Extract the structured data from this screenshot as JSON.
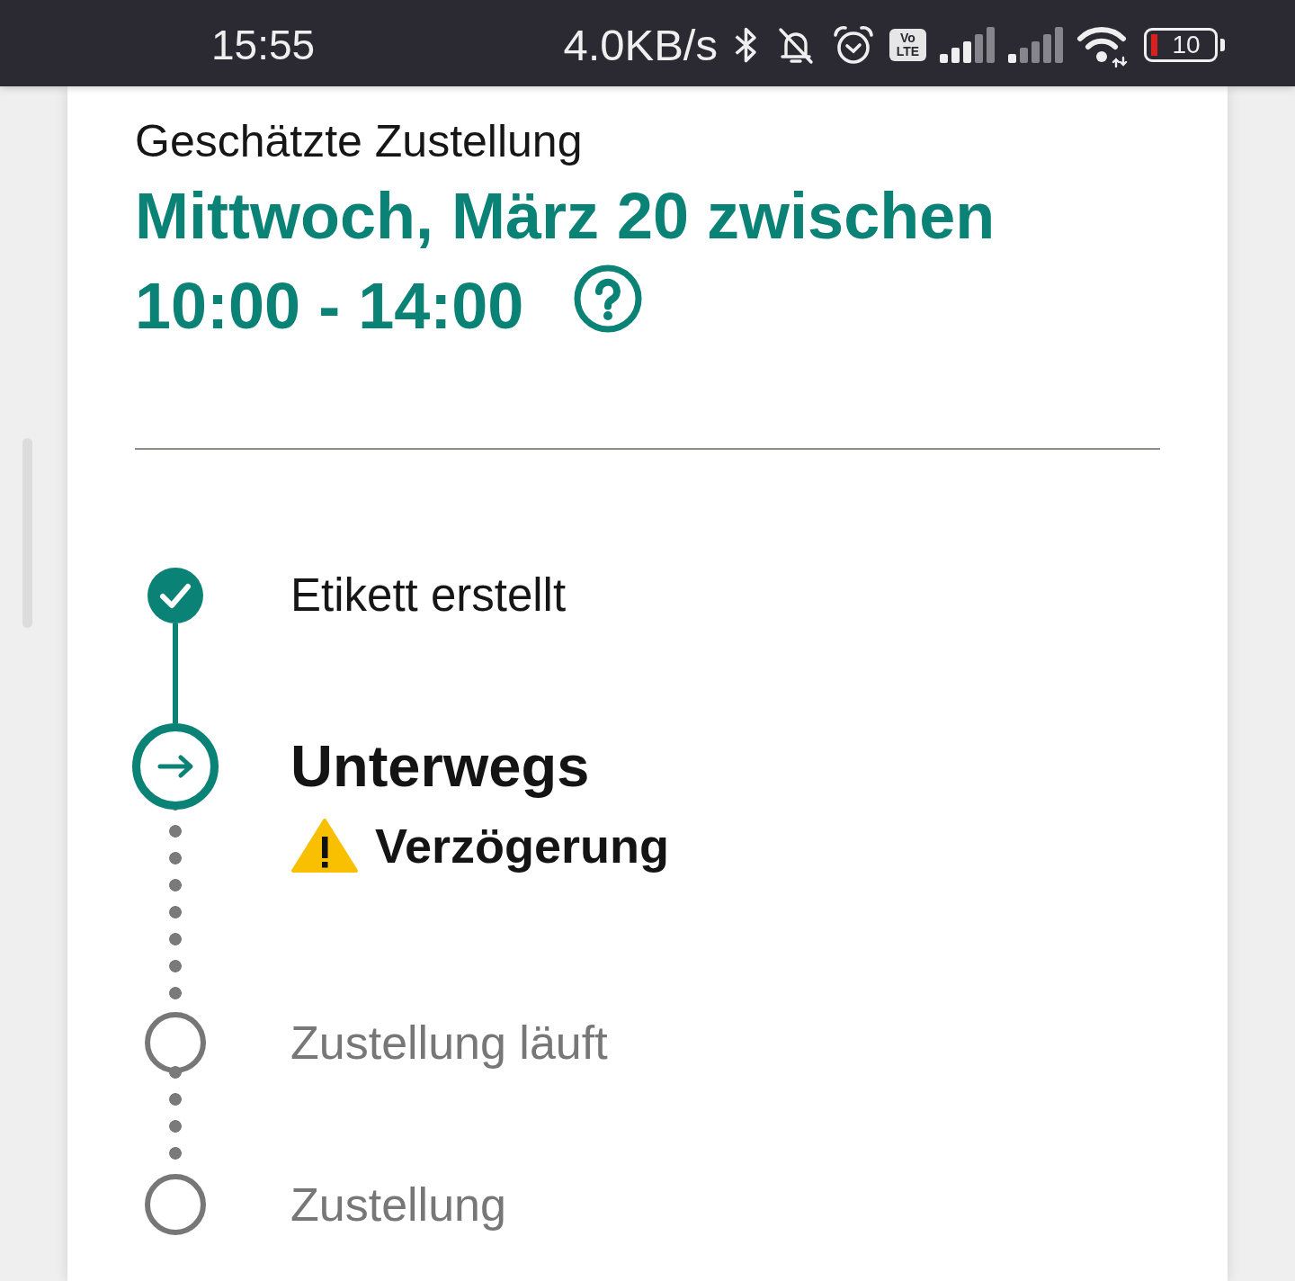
{
  "status_bar": {
    "time": "15:55",
    "net_speed": "4.0KB/s",
    "volte": "Vo LTE",
    "battery": "10"
  },
  "delivery": {
    "label": "Geschätzte Zustellung",
    "date": "Mittwoch, März 20 zwischen",
    "time": "10:00 - 14:00"
  },
  "steps": [
    {
      "label": "Etikett erstellt",
      "completed": true,
      "active": false
    },
    {
      "label": "Unterwegs",
      "completed": false,
      "active": true,
      "warning": "Verzögerung"
    },
    {
      "label": "Zustellung läuft",
      "completed": false,
      "active": false
    },
    {
      "label": "Zustellung",
      "completed": false,
      "active": false
    }
  ]
}
